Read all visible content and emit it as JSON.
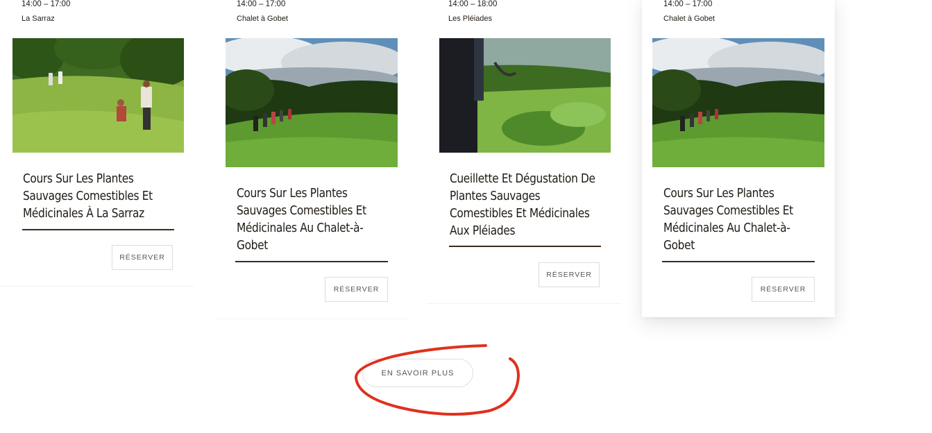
{
  "cards": [
    {
      "time": "14:00 – 17:00",
      "place": "La Sarraz",
      "title": "Cours Sur Les Plantes Sauvages Comestibles Et Médicinales À La Sarraz",
      "button": "RÉSERVER",
      "image": "meadow-foraging-photo"
    },
    {
      "time": "14:00 – 17:00",
      "place": "Chalet à Gobet",
      "title": "Cours Sur Les Plantes Sauvages Comestibles Et Médicinales Au Chalet-à-Gobet",
      "button": "RÉSERVER",
      "image": "hillside-group-photo"
    },
    {
      "time": "14:00 – 18:00",
      "place": "Les Pléiades",
      "title": "Cueillette Et Dégustation De Plantes Sauvages Comestibles Et Médicinales Aux Pléiades",
      "button": "RÉSERVER",
      "image": "harvesting-plants-photo"
    },
    {
      "time": "14:00 – 17:00",
      "place": "Chalet à Gobet",
      "title": "Cours Sur Les Plantes Sauvages Comestibles Et Médicinales Au Chalet-à-Gobet",
      "button": "RÉSERVER",
      "image": "hillside-group-photo"
    }
  ],
  "more_button": "EN SAVOIR PLUS",
  "colors": {
    "text": "#1f1a14",
    "rule": "#3a2c1c",
    "annotation": "#e0301e"
  }
}
